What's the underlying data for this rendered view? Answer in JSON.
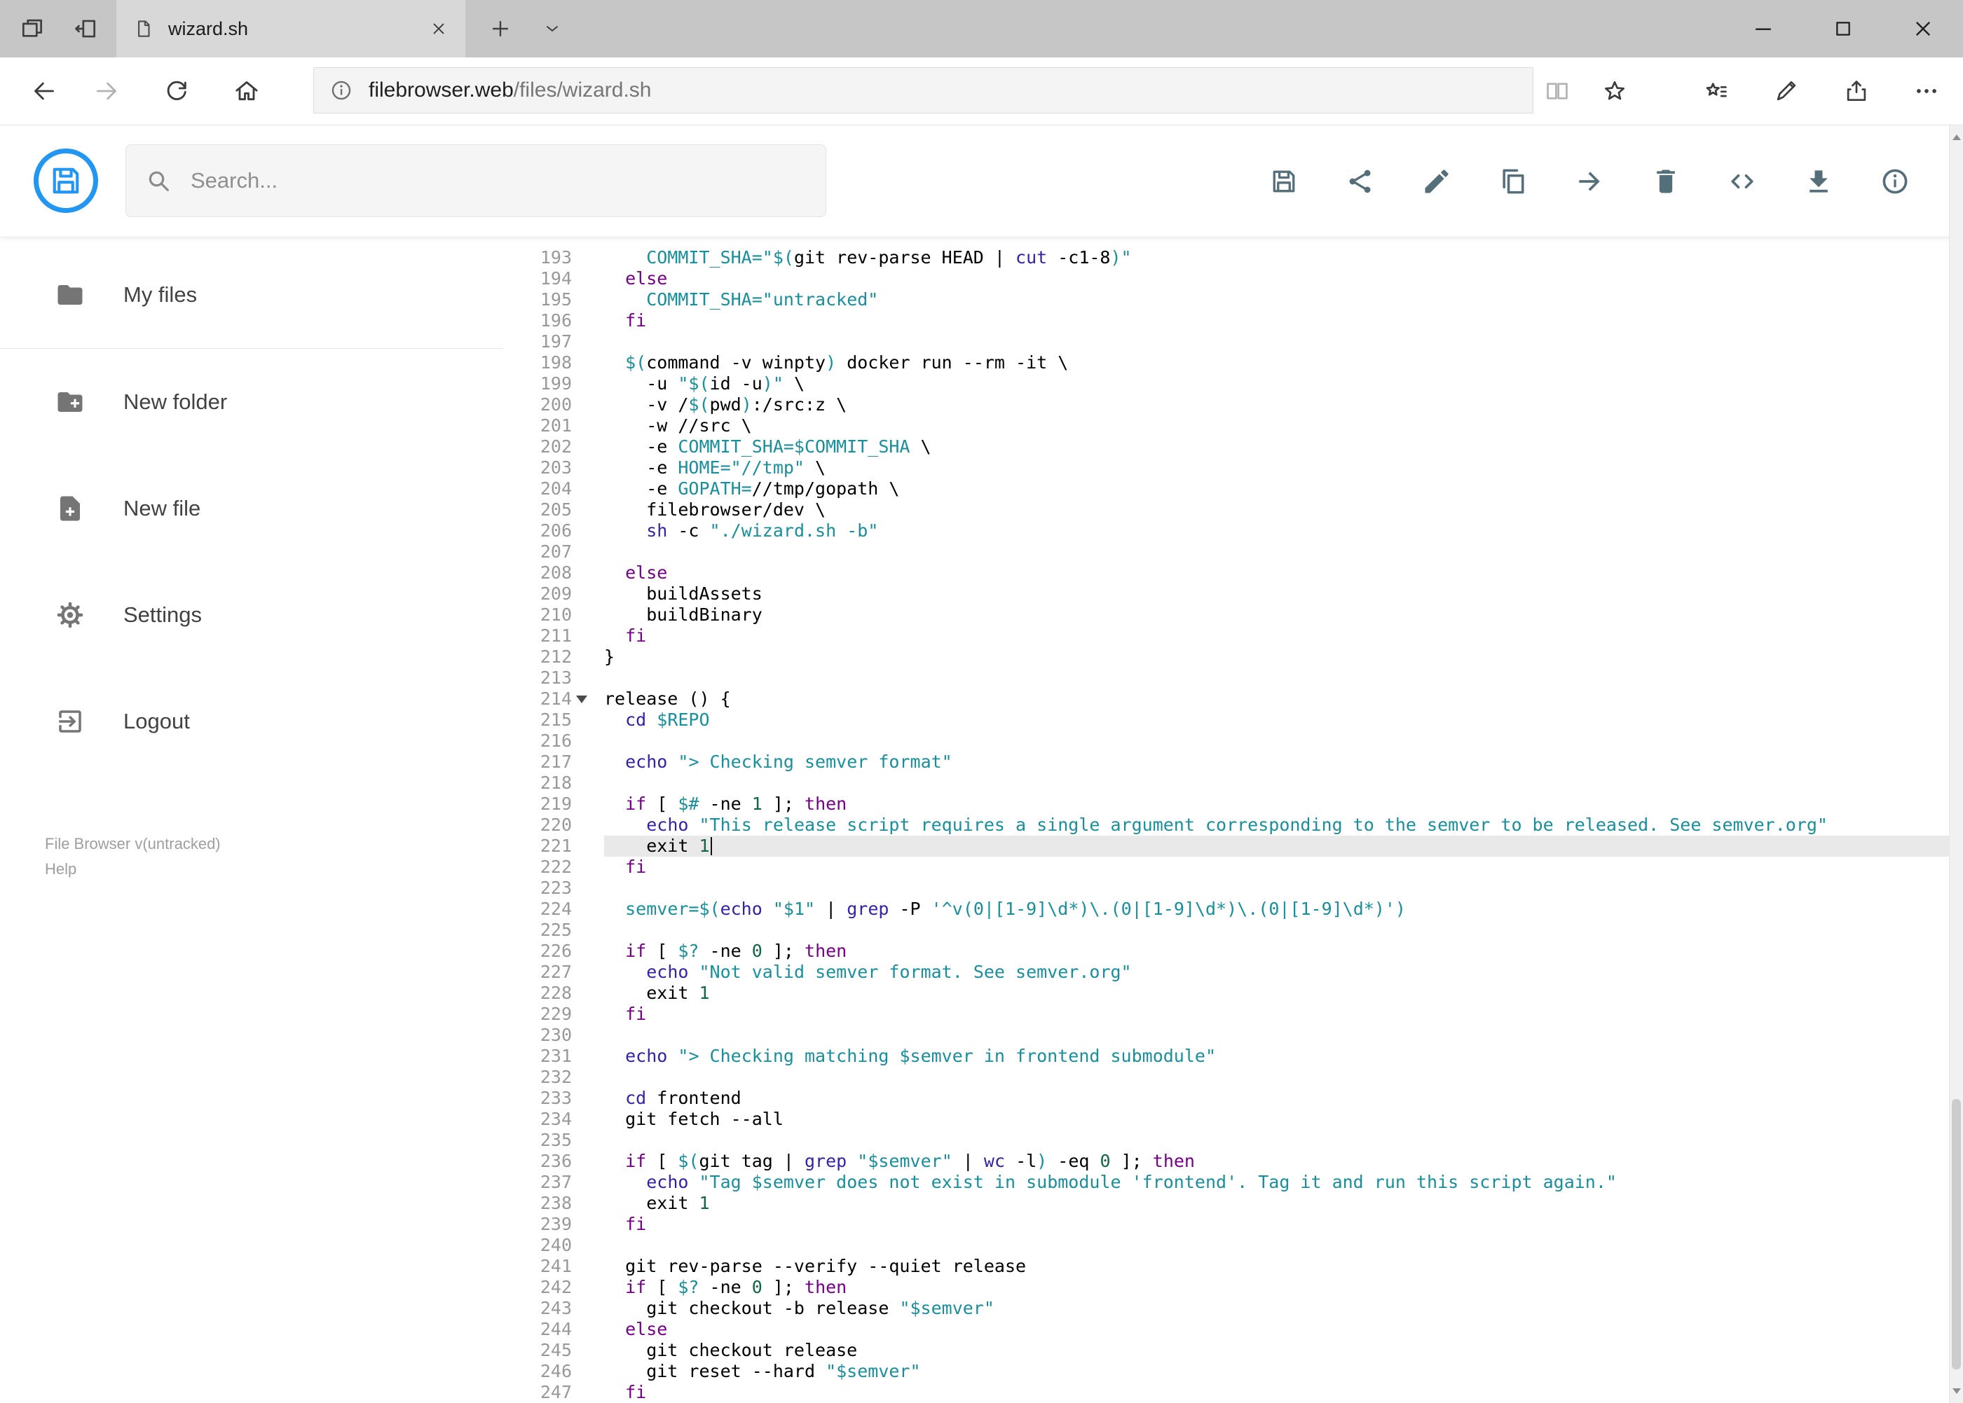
{
  "browser": {
    "tab_title": "wizard.sh",
    "url_host": "filebrowser.web",
    "url_path": "/files/wizard.sh"
  },
  "header": {
    "search_placeholder": "Search...",
    "toolbar_icons": [
      "save",
      "share",
      "rename",
      "copy",
      "move",
      "delete",
      "editor",
      "download",
      "info"
    ]
  },
  "sidebar": {
    "items": [
      {
        "label": "My files",
        "icon": "folder-icon"
      },
      {
        "label": "New folder",
        "icon": "new-folder-icon"
      },
      {
        "label": "New file",
        "icon": "new-file-icon"
      },
      {
        "label": "Settings",
        "icon": "settings-icon"
      },
      {
        "label": "Logout",
        "icon": "logout-icon"
      }
    ],
    "footer": {
      "version": "File Browser v(untracked)",
      "help": "Help"
    }
  },
  "editor": {
    "language": "shell",
    "first_line": 193,
    "last_line": 247,
    "active_line": 221,
    "lines": [
      {
        "n": 193,
        "t": [
          [
            "    COMMIT_SHA=",
            "v"
          ],
          [
            "\"$(",
            "s"
          ],
          [
            "git rev-parse HEAD | ",
            "p"
          ],
          [
            "cut",
            "b"
          ],
          [
            " -c1-8",
            "p"
          ],
          [
            ")\"",
            "s"
          ]
        ]
      },
      {
        "n": 194,
        "t": [
          [
            "  else",
            "k"
          ]
        ]
      },
      {
        "n": 195,
        "t": [
          [
            "    COMMIT_SHA=",
            "v"
          ],
          [
            "\"untracked\"",
            "s"
          ]
        ]
      },
      {
        "n": 196,
        "t": [
          [
            "  fi",
            "k"
          ]
        ]
      },
      {
        "n": 197,
        "t": []
      },
      {
        "n": 198,
        "t": [
          [
            "  ",
            "p"
          ],
          [
            "$(",
            "s"
          ],
          [
            "command -v winpty",
            "p"
          ],
          [
            ")",
            "s"
          ],
          [
            " docker run --rm -it \\",
            "p"
          ]
        ]
      },
      {
        "n": 199,
        "t": [
          [
            "    -u ",
            "p"
          ],
          [
            "\"$(",
            "s"
          ],
          [
            "id -u",
            "p"
          ],
          [
            ")\"",
            "s"
          ],
          [
            " \\",
            "p"
          ]
        ]
      },
      {
        "n": 200,
        "t": [
          [
            "    -v /",
            "p"
          ],
          [
            "$(",
            "s"
          ],
          [
            "pwd",
            "p"
          ],
          [
            ")",
            "s"
          ],
          [
            ":/src:z \\",
            "p"
          ]
        ]
      },
      {
        "n": 201,
        "t": [
          [
            "    -w //src \\",
            "p"
          ]
        ]
      },
      {
        "n": 202,
        "t": [
          [
            "    -e ",
            "p"
          ],
          [
            "COMMIT_SHA=$COMMIT_SHA",
            "v"
          ],
          [
            " \\",
            "p"
          ]
        ]
      },
      {
        "n": 203,
        "t": [
          [
            "    -e ",
            "p"
          ],
          [
            "HOME=",
            "v"
          ],
          [
            "\"//tmp\"",
            "s"
          ],
          [
            " \\",
            "p"
          ]
        ]
      },
      {
        "n": 204,
        "t": [
          [
            "    -e ",
            "p"
          ],
          [
            "GOPATH=",
            "v"
          ],
          [
            "//tmp/gopath \\",
            "p"
          ]
        ]
      },
      {
        "n": 205,
        "t": [
          [
            "    filebrowser/dev \\",
            "p"
          ]
        ]
      },
      {
        "n": 206,
        "t": [
          [
            "    ",
            "p"
          ],
          [
            "sh",
            "b"
          ],
          [
            " -c ",
            "p"
          ],
          [
            "\"./wizard.sh -b\"",
            "s"
          ]
        ]
      },
      {
        "n": 207,
        "t": []
      },
      {
        "n": 208,
        "t": [
          [
            "  else",
            "k"
          ]
        ]
      },
      {
        "n": 209,
        "t": [
          [
            "    buildAssets",
            "p"
          ]
        ]
      },
      {
        "n": 210,
        "t": [
          [
            "    buildBinary",
            "p"
          ]
        ]
      },
      {
        "n": 211,
        "t": [
          [
            "  fi",
            "k"
          ]
        ]
      },
      {
        "n": 212,
        "t": [
          [
            "}",
            "p"
          ]
        ]
      },
      {
        "n": 213,
        "t": []
      },
      {
        "n": 214,
        "fold": true,
        "t": [
          [
            "release () {",
            "p"
          ]
        ]
      },
      {
        "n": 215,
        "t": [
          [
            "  ",
            "p"
          ],
          [
            "cd",
            "b"
          ],
          [
            " ",
            "p"
          ],
          [
            "$REPO",
            "v"
          ]
        ]
      },
      {
        "n": 216,
        "t": []
      },
      {
        "n": 217,
        "t": [
          [
            "  ",
            "p"
          ],
          [
            "echo",
            "b"
          ],
          [
            " ",
            "p"
          ],
          [
            "\"> Checking semver format\"",
            "s"
          ]
        ]
      },
      {
        "n": 218,
        "t": []
      },
      {
        "n": 219,
        "t": [
          [
            "  ",
            "p"
          ],
          [
            "if",
            "k"
          ],
          [
            " [ ",
            "p"
          ],
          [
            "$#",
            "v"
          ],
          [
            " -ne ",
            "p"
          ],
          [
            "1",
            "n"
          ],
          [
            " ]; ",
            "p"
          ],
          [
            "then",
            "k"
          ]
        ]
      },
      {
        "n": 220,
        "t": [
          [
            "    ",
            "p"
          ],
          [
            "echo",
            "b"
          ],
          [
            " ",
            "p"
          ],
          [
            "\"This release script requires a single argument corresponding to the semver to be released. See semver.org\"",
            "s"
          ]
        ]
      },
      {
        "n": 221,
        "cursor": true,
        "t": [
          [
            "    exit ",
            "p"
          ],
          [
            "1",
            "n"
          ]
        ]
      },
      {
        "n": 222,
        "t": [
          [
            "  fi",
            "k"
          ]
        ]
      },
      {
        "n": 223,
        "t": []
      },
      {
        "n": 224,
        "t": [
          [
            "  ",
            "p"
          ],
          [
            "semver=",
            "v"
          ],
          [
            "$(",
            "s"
          ],
          [
            "echo",
            "b"
          ],
          [
            " ",
            "p"
          ],
          [
            "\"$1\"",
            "s"
          ],
          [
            " | ",
            "p"
          ],
          [
            "grep",
            "b"
          ],
          [
            " -P ",
            "p"
          ],
          [
            "'^v(0|[1-9]\\d*)\\.(0|[1-9]\\d*)\\.(0|[1-9]\\d*)')",
            "s"
          ]
        ]
      },
      {
        "n": 225,
        "t": []
      },
      {
        "n": 226,
        "t": [
          [
            "  ",
            "p"
          ],
          [
            "if",
            "k"
          ],
          [
            " [ ",
            "p"
          ],
          [
            "$?",
            "v"
          ],
          [
            " -ne ",
            "p"
          ],
          [
            "0",
            "n"
          ],
          [
            " ]; ",
            "p"
          ],
          [
            "then",
            "k"
          ]
        ]
      },
      {
        "n": 227,
        "t": [
          [
            "    ",
            "p"
          ],
          [
            "echo",
            "b"
          ],
          [
            " ",
            "p"
          ],
          [
            "\"Not valid semver format. See semver.org\"",
            "s"
          ]
        ]
      },
      {
        "n": 228,
        "t": [
          [
            "    exit ",
            "p"
          ],
          [
            "1",
            "n"
          ]
        ]
      },
      {
        "n": 229,
        "t": [
          [
            "  fi",
            "k"
          ]
        ]
      },
      {
        "n": 230,
        "t": []
      },
      {
        "n": 231,
        "t": [
          [
            "  ",
            "p"
          ],
          [
            "echo",
            "b"
          ],
          [
            " ",
            "p"
          ],
          [
            "\"> Checking matching $semver in frontend submodule\"",
            "s"
          ]
        ]
      },
      {
        "n": 232,
        "t": []
      },
      {
        "n": 233,
        "t": [
          [
            "  ",
            "p"
          ],
          [
            "cd",
            "b"
          ],
          [
            " frontend",
            "p"
          ]
        ]
      },
      {
        "n": 234,
        "t": [
          [
            "  git fetch --all",
            "p"
          ]
        ]
      },
      {
        "n": 235,
        "t": []
      },
      {
        "n": 236,
        "t": [
          [
            "  ",
            "p"
          ],
          [
            "if",
            "k"
          ],
          [
            " [ ",
            "p"
          ],
          [
            "$(",
            "s"
          ],
          [
            "git tag | ",
            "p"
          ],
          [
            "grep",
            "b"
          ],
          [
            " ",
            "p"
          ],
          [
            "\"$semver\"",
            "s"
          ],
          [
            " | ",
            "p"
          ],
          [
            "wc",
            "b"
          ],
          [
            " -l",
            "p"
          ],
          [
            ")",
            "s"
          ],
          [
            " -eq ",
            "p"
          ],
          [
            "0",
            "n"
          ],
          [
            " ]; ",
            "p"
          ],
          [
            "then",
            "k"
          ]
        ]
      },
      {
        "n": 237,
        "t": [
          [
            "    ",
            "p"
          ],
          [
            "echo",
            "b"
          ],
          [
            " ",
            "p"
          ],
          [
            "\"Tag $semver does not exist in submodule 'frontend'. Tag it and run this script again.\"",
            "s"
          ]
        ]
      },
      {
        "n": 238,
        "t": [
          [
            "    exit ",
            "p"
          ],
          [
            "1",
            "n"
          ]
        ]
      },
      {
        "n": 239,
        "t": [
          [
            "  fi",
            "k"
          ]
        ]
      },
      {
        "n": 240,
        "t": []
      },
      {
        "n": 241,
        "t": [
          [
            "  git rev-parse --verify --quiet release",
            "p"
          ]
        ]
      },
      {
        "n": 242,
        "t": [
          [
            "  ",
            "p"
          ],
          [
            "if",
            "k"
          ],
          [
            " [ ",
            "p"
          ],
          [
            "$?",
            "v"
          ],
          [
            " -ne ",
            "p"
          ],
          [
            "0",
            "n"
          ],
          [
            " ]; ",
            "p"
          ],
          [
            "then",
            "k"
          ]
        ]
      },
      {
        "n": 243,
        "t": [
          [
            "    git checkout -b release ",
            "p"
          ],
          [
            "\"$semver\"",
            "s"
          ]
        ]
      },
      {
        "n": 244,
        "t": [
          [
            "  else",
            "k"
          ]
        ]
      },
      {
        "n": 245,
        "t": [
          [
            "    git checkout release",
            "p"
          ]
        ]
      },
      {
        "n": 246,
        "t": [
          [
            "    git reset --hard ",
            "p"
          ],
          [
            "\"$semver\"",
            "s"
          ]
        ]
      },
      {
        "n": 247,
        "t": [
          [
            "  fi",
            "k"
          ]
        ]
      }
    ]
  },
  "colors": {
    "accent": "#2196f3",
    "plain": "#000000",
    "keyword": "#770088",
    "builtin": "#3322aa",
    "string": "#17909c",
    "variable": "#17909c",
    "number": "#116644",
    "line_number": "#999999",
    "active_line_bg": "#e9e9e9"
  }
}
